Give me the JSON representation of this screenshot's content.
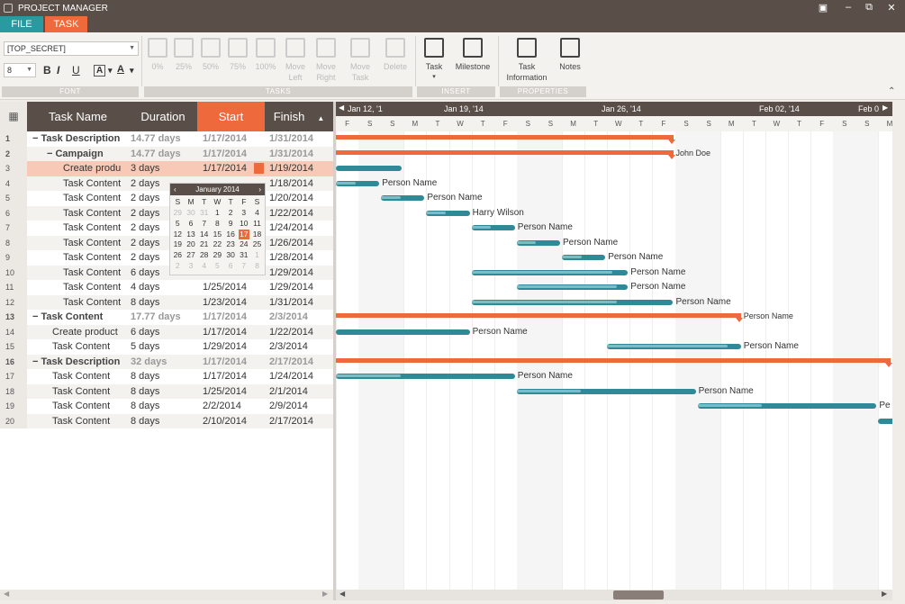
{
  "app": {
    "title": "PROJECT MANAGER"
  },
  "menu": {
    "file": "FILE",
    "task": "TASK"
  },
  "ribbon": {
    "font_combo": "[TOP_SECRET]",
    "size_combo": "8",
    "bold": "B",
    "italic": "I",
    "underline": "U",
    "groups": {
      "font": "FONT",
      "tasks": "TASKS",
      "insert": "INSERT",
      "properties": "PROPERTIES"
    },
    "progress": [
      "0%",
      "25%",
      "50%",
      "75%",
      "100%"
    ],
    "move_left": [
      "Move",
      "Left"
    ],
    "move_right": [
      "Move",
      "Right"
    ],
    "move_task": [
      "Move",
      "Task"
    ],
    "delete": "Delete",
    "task": "Task",
    "milestone": "Milestone",
    "task_info": [
      "Task",
      "Information"
    ],
    "notes": "Notes"
  },
  "grid": {
    "headers": {
      "name": "Task Name",
      "duration": "Duration",
      "start": "Start",
      "finish": "Finish"
    },
    "rows": [
      {
        "n": "1",
        "name": "Task Description",
        "dur": "14.77 days",
        "start": "1/17/2014",
        "finish": "1/31/2014",
        "level": 0,
        "summary": true
      },
      {
        "n": "2",
        "name": "Campaign",
        "dur": "14.77 days",
        "start": "1/17/2014",
        "finish": "1/31/2014",
        "level": 1,
        "summary": true
      },
      {
        "n": "3",
        "name": "Create produ",
        "dur": "3 days",
        "start": "1/17/2014",
        "finish": "1/19/2014",
        "level": 2,
        "summary": false
      },
      {
        "n": "4",
        "name": "Task Content",
        "dur": "2 days",
        "start": "",
        "finish": "1/18/2014",
        "level": 2,
        "summary": false
      },
      {
        "n": "5",
        "name": "Task Content",
        "dur": "2 days",
        "start": "",
        "finish": "1/20/2014",
        "level": 2,
        "summary": false
      },
      {
        "n": "6",
        "name": "Task Content",
        "dur": "2 days",
        "start": "",
        "finish": "1/22/2014",
        "level": 2,
        "summary": false
      },
      {
        "n": "7",
        "name": "Task Content",
        "dur": "2 days",
        "start": "",
        "finish": "1/24/2014",
        "level": 2,
        "summary": false
      },
      {
        "n": "8",
        "name": "Task Content",
        "dur": "2 days",
        "start": "",
        "finish": "1/26/2014",
        "level": 2,
        "summary": false
      },
      {
        "n": "9",
        "name": "Task Content",
        "dur": "2 days",
        "start": "",
        "finish": "1/28/2014",
        "level": 2,
        "summary": false
      },
      {
        "n": "10",
        "name": "Task Content",
        "dur": "6 days",
        "start": "1/23/2014",
        "finish": "1/29/2014",
        "level": 2,
        "summary": false
      },
      {
        "n": "11",
        "name": "Task Content",
        "dur": "4 days",
        "start": "1/25/2014",
        "finish": "1/29/2014",
        "level": 2,
        "summary": false
      },
      {
        "n": "12",
        "name": "Task Content",
        "dur": "8 days",
        "start": "1/23/2014",
        "finish": "1/31/2014",
        "level": 2,
        "summary": false
      },
      {
        "n": "13",
        "name": "Task Content",
        "dur": "17.77 days",
        "start": "1/17/2014",
        "finish": "2/3/2014",
        "level": 0,
        "summary": true
      },
      {
        "n": "14",
        "name": "Create product",
        "dur": "6 days",
        "start": "1/17/2014",
        "finish": "1/22/2014",
        "level": 1,
        "summary": false
      },
      {
        "n": "15",
        "name": "Task Content",
        "dur": "5 days",
        "start": "1/29/2014",
        "finish": "2/3/2014",
        "level": 1,
        "summary": false
      },
      {
        "n": "16",
        "name": "Task Description",
        "dur": "32 days",
        "start": "1/17/2014",
        "finish": "2/17/2014",
        "level": 0,
        "summary": true
      },
      {
        "n": "17",
        "name": "Task Content",
        "dur": "8 days",
        "start": "1/17/2014",
        "finish": "1/24/2014",
        "level": 1,
        "summary": false
      },
      {
        "n": "18",
        "name": "Task Content",
        "dur": "8 days",
        "start": "1/25/2014",
        "finish": "2/1/2014",
        "level": 1,
        "summary": false
      },
      {
        "n": "19",
        "name": "Task Content",
        "dur": "8 days",
        "start": "2/2/2014",
        "finish": "2/9/2014",
        "level": 1,
        "summary": false
      },
      {
        "n": "20",
        "name": "Task Content",
        "dur": "8 days",
        "start": "2/10/2014",
        "finish": "2/17/2014",
        "level": 1,
        "summary": false
      }
    ]
  },
  "calendar": {
    "month": "January 2014",
    "weekdays": [
      "S",
      "M",
      "T",
      "W",
      "T",
      "F",
      "S"
    ],
    "weeks": [
      [
        "29",
        "30",
        "31",
        "1",
        "2",
        "3",
        "4"
      ],
      [
        "5",
        "6",
        "7",
        "8",
        "9",
        "10",
        "11"
      ],
      [
        "12",
        "13",
        "14",
        "15",
        "16",
        "17",
        "18"
      ],
      [
        "19",
        "20",
        "21",
        "22",
        "23",
        "24",
        "25"
      ],
      [
        "26",
        "27",
        "28",
        "29",
        "30",
        "31",
        "1"
      ],
      [
        "2",
        "3",
        "4",
        "5",
        "6",
        "7",
        "8"
      ]
    ],
    "selected": "17"
  },
  "timeline": {
    "weeks": [
      "Jan 12, '1",
      "Jan 19, '14",
      "Jan 26, '14",
      "Feb 02, '14",
      "Feb 0"
    ],
    "days": [
      "F",
      "S",
      "S",
      "M",
      "T",
      "W",
      "T",
      "F",
      "S",
      "S",
      "M",
      "T",
      "W",
      "T",
      "F",
      "S",
      "S",
      "M",
      "T",
      "W",
      "T",
      "F",
      "S",
      "S",
      "M"
    ],
    "bars": [
      {
        "row": 1,
        "start": 0,
        "end": 15.0,
        "type": "summary",
        "label": ""
      },
      {
        "row": 2,
        "start": 0,
        "end": 15.0,
        "type": "summary",
        "label": "John Doe"
      },
      {
        "row": 3,
        "start": 0,
        "end": 3.0,
        "type": "task",
        "progress": 0,
        "label": ""
      },
      {
        "row": 4,
        "start": 0,
        "end": 2.0,
        "type": "task",
        "progress": 0.5,
        "label": "Person Name"
      },
      {
        "row": 5,
        "start": 2.0,
        "end": 4.0,
        "type": "task",
        "progress": 0.5,
        "label": "Person Name"
      },
      {
        "row": 6,
        "start": 4.0,
        "end": 6.0,
        "type": "task",
        "progress": 0.5,
        "label": "Harry Wilson"
      },
      {
        "row": 7,
        "start": 6.0,
        "end": 8.0,
        "type": "task",
        "progress": 0.5,
        "label": "Person Name"
      },
      {
        "row": 8,
        "start": 8.0,
        "end": 10.0,
        "type": "task",
        "progress": 0.5,
        "label": "Person Name"
      },
      {
        "row": 9,
        "start": 10.0,
        "end": 12.0,
        "type": "task",
        "progress": 0.5,
        "label": "Person Name"
      },
      {
        "row": 10,
        "start": 6.0,
        "end": 13.0,
        "type": "task",
        "progress": 1,
        "label": "Person Name"
      },
      {
        "row": 11,
        "start": 8.0,
        "end": 13.0,
        "type": "task",
        "progress": 1,
        "label": "Person Name"
      },
      {
        "row": 12,
        "start": 6.0,
        "end": 15.0,
        "type": "task",
        "progress": 0.8,
        "label": "Person Name"
      },
      {
        "row": 13,
        "start": 0,
        "end": 18.0,
        "type": "summary",
        "label": "Person Name"
      },
      {
        "row": 14,
        "start": 0,
        "end": 6.0,
        "type": "task",
        "progress": 0,
        "label": "Person Name"
      },
      {
        "row": 15,
        "start": 12.0,
        "end": 18.0,
        "type": "task",
        "progress": 1,
        "label": "Person Name"
      },
      {
        "row": 16,
        "start": 0,
        "end": 25.0,
        "type": "summary",
        "label": ""
      },
      {
        "row": 17,
        "start": 0,
        "end": 8.0,
        "type": "task",
        "progress": 0.4,
        "label": "Person Name"
      },
      {
        "row": 18,
        "start": 8.0,
        "end": 16.0,
        "type": "task",
        "progress": 0.4,
        "label": "Person Name"
      },
      {
        "row": 19,
        "start": 16.0,
        "end": 24.0,
        "type": "task",
        "progress": 0.4,
        "label": "Pe"
      },
      {
        "row": 20,
        "start": 24.0,
        "end": 25.0,
        "type": "task",
        "progress": 0,
        "label": ""
      }
    ]
  },
  "colors": {
    "accent": "#ee6a3c",
    "teal": "#2e8a96",
    "tealLight": "#7cbcc4",
    "header": "#5a4f48",
    "fileTab": "#2a9aa2"
  }
}
